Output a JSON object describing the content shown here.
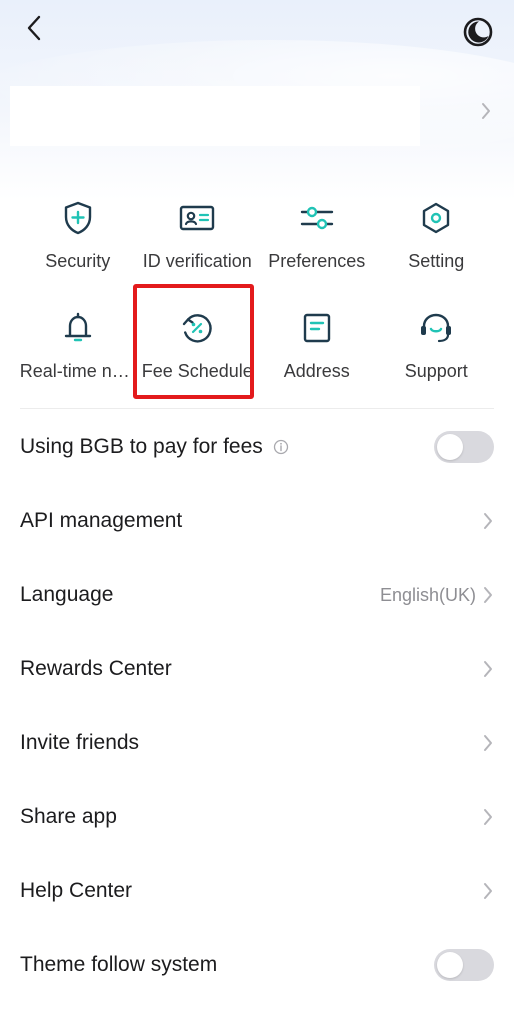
{
  "header": {
    "back_icon": "chevron-left-icon",
    "theme_icon": "moon-icon"
  },
  "grid": [
    {
      "label": "Security",
      "icon": "shield-plus-icon"
    },
    {
      "label": "ID verification",
      "icon": "id-card-icon"
    },
    {
      "label": "Preferences",
      "icon": "sliders-icon"
    },
    {
      "label": "Setting",
      "icon": "hexagon-gear-icon"
    },
    {
      "label": "Real-time notifications",
      "icon": "bell-icon"
    },
    {
      "label": "Fee Schedule",
      "icon": "percent-circle-icon"
    },
    {
      "label": "Address",
      "icon": "document-icon"
    },
    {
      "label": "Support",
      "icon": "headset-icon"
    }
  ],
  "list": {
    "bgb_fees": {
      "label": "Using BGB to pay for fees",
      "enabled": false
    },
    "api_management": {
      "label": "API management"
    },
    "language": {
      "label": "Language",
      "value": "English(UK)"
    },
    "rewards_center": {
      "label": "Rewards Center"
    },
    "invite_friends": {
      "label": "Invite friends"
    },
    "share_app": {
      "label": "Share app"
    },
    "help_center": {
      "label": "Help Center"
    },
    "theme_follow_system": {
      "label": "Theme follow system",
      "enabled": false
    }
  },
  "colors": {
    "accent": "#1f3b4d",
    "highlight": "#e31a1c",
    "toggle_off": "#d9d9de"
  }
}
